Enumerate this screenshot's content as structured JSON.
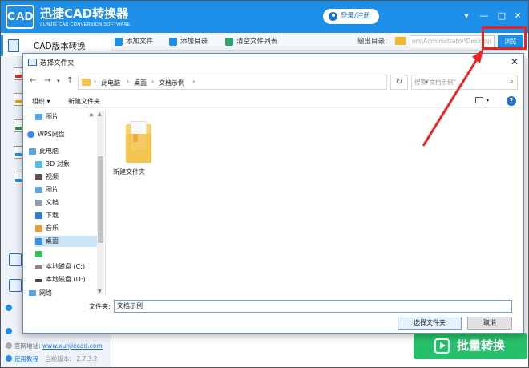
{
  "app": {
    "logo": "CAD",
    "name": "迅捷CAD转换器",
    "subtitle": "XUNJIE CAD CONVERSION SOFTWARE",
    "login": "登录/注册",
    "accent": "#1e8fe8"
  },
  "sidebar": {
    "active_item": "CAD版本转换",
    "bottom": {
      "website_label": "官网地址:",
      "website": "www.xunjiecad.com",
      "tutorial": "使用教程",
      "version_label": "当前版本:",
      "version": "2.7.3.2"
    }
  },
  "toolbar": {
    "add_file": "添加文件",
    "add_dir": "添加目录",
    "clear_list": "清空文件列表",
    "output_label": "输出目录:",
    "output_path": "ers\\Administrator\\Desktop",
    "browse": "浏览"
  },
  "batch": {
    "label": "批量转换"
  },
  "dialog": {
    "title": "选择文件夹",
    "breadcrumb": [
      "此电脑",
      "桌面",
      "文档示例"
    ],
    "search_placeholder": "搜索\"文档示例\"",
    "organize": "组织 ▾",
    "new_folder": "新建文件夹",
    "tree": {
      "pictures_quick": "图片",
      "wps": "WPS网盘",
      "this_pc": "此电脑",
      "objects3d": "3D 对象",
      "videos": "视频",
      "pictures": "图片",
      "documents": "文档",
      "downloads": "下载",
      "music": "音乐",
      "desktop": "桌面",
      "drive_c": "本地磁盘 (C:)",
      "drive_d": "本地磁盘 (D:)",
      "network": "网络"
    },
    "folder_item": "新建文件夹",
    "filename_label": "文件夹:",
    "filename_value": "文档示例",
    "ok": "选择文件夹",
    "cancel": "取消"
  }
}
